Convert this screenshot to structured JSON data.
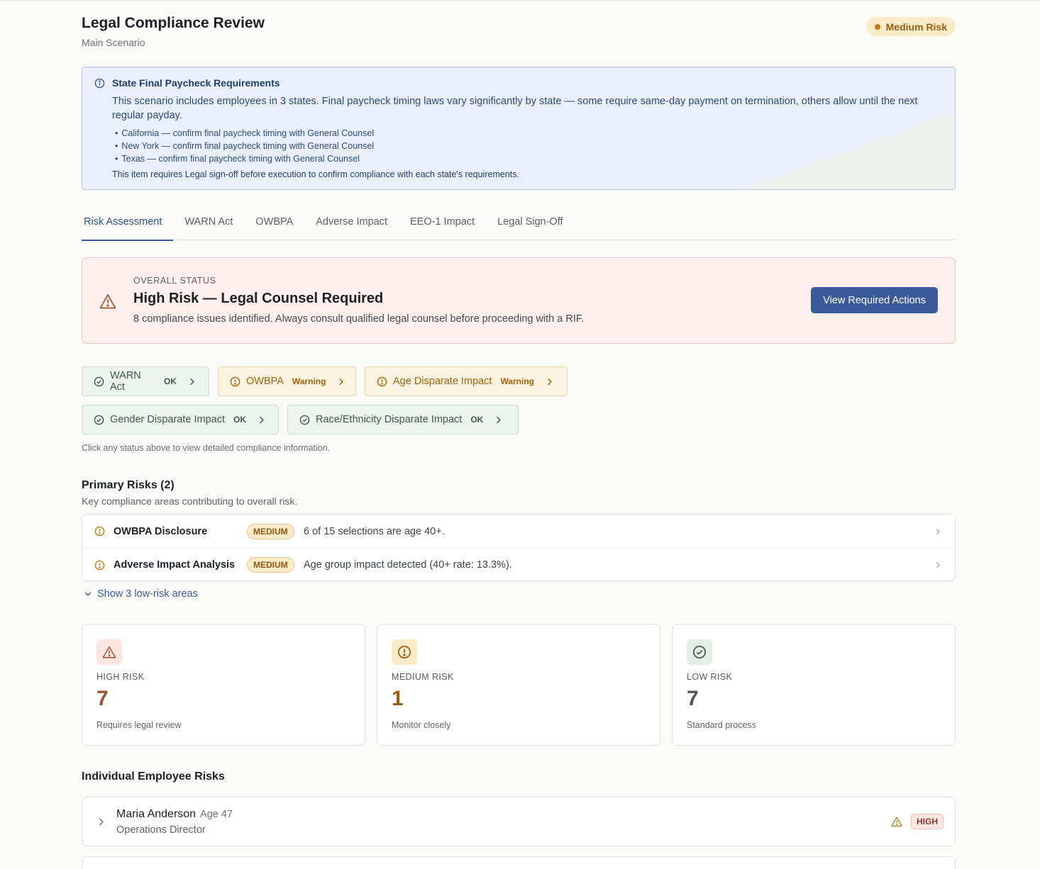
{
  "header": {
    "title": "Legal Compliance Review",
    "subtitle": "Main Scenario",
    "risk_pill": "Medium Risk"
  },
  "banner": {
    "title": "State Final Paycheck Requirements",
    "description": "This scenario includes employees in 3 states. Final paycheck timing laws vary significantly by state — some require same-day payment on termination, others allow until the next regular payday.",
    "items": [
      "California — confirm final paycheck timing with General Counsel",
      "New York — confirm final paycheck timing with General Counsel",
      "Texas — confirm final paycheck timing with General Counsel"
    ],
    "note": "This item requires Legal sign-off before execution to confirm compliance with each state's requirements."
  },
  "tabs": [
    {
      "label": "Risk Assessment",
      "active": true
    },
    {
      "label": "WARN Act"
    },
    {
      "label": "OWBPA"
    },
    {
      "label": "Adverse Impact"
    },
    {
      "label": "EEO-1 Impact"
    },
    {
      "label": "Legal Sign-Off"
    }
  ],
  "overall": {
    "label": "OVERALL STATUS",
    "headline": "High Risk — Legal Counsel Required",
    "description": "8 compliance issues identified. Always consult qualified legal counsel before proceeding with a RIF.",
    "action_label": "View Required Actions"
  },
  "chips": [
    {
      "label": "WARN Act",
      "status": "OK"
    },
    {
      "label": "OWBPA",
      "status": "Warning"
    },
    {
      "label": "Age Disparate Impact",
      "status": "Warning"
    },
    {
      "label": "Gender Disparate Impact",
      "status": "OK"
    },
    {
      "label": "Race/Ethnicity Disparate Impact",
      "status": "OK"
    }
  ],
  "chip_hint": "Click any status above to view detailed compliance information.",
  "primary_risks": {
    "title": "Primary Risks (2)",
    "subtitle": "Key compliance areas contributing to overall risk.",
    "rows": [
      {
        "name": "OWBPA Disclosure",
        "level": "MEDIUM",
        "description": "6 of 15 selections are age 40+."
      },
      {
        "name": "Adverse Impact Analysis",
        "level": "MEDIUM",
        "description": "Age group impact detected (40+ rate: 13.3%)."
      }
    ],
    "show_more": "Show 3 low-risk areas"
  },
  "stats": [
    {
      "label": "HIGH RISK",
      "value": "7",
      "note": "Requires legal review",
      "icon": "warning-triangle-icon",
      "color": "#a0522d",
      "bg": "#fbe6e1"
    },
    {
      "label": "MEDIUM RISK",
      "value": "1",
      "note": "Monitor closely",
      "icon": "alert-circle-icon",
      "color": "#9a5b12",
      "bg": "#fbecc9"
    },
    {
      "label": "LOW RISK",
      "value": "7",
      "note": "Standard process",
      "icon": "check-circle-icon",
      "color": "#4b5a52",
      "bg": "#e4ece6"
    }
  ],
  "employees": {
    "title": "Individual Employee Risks",
    "rows": [
      {
        "name": "Maria Anderson",
        "age": "Age 47",
        "title": "Operations Director",
        "level": "HIGH"
      }
    ]
  },
  "colors": {
    "accent": "#3a5a9c",
    "ok": "#3f5a48",
    "warning": "#a0620d",
    "danger": "#a0522d"
  }
}
